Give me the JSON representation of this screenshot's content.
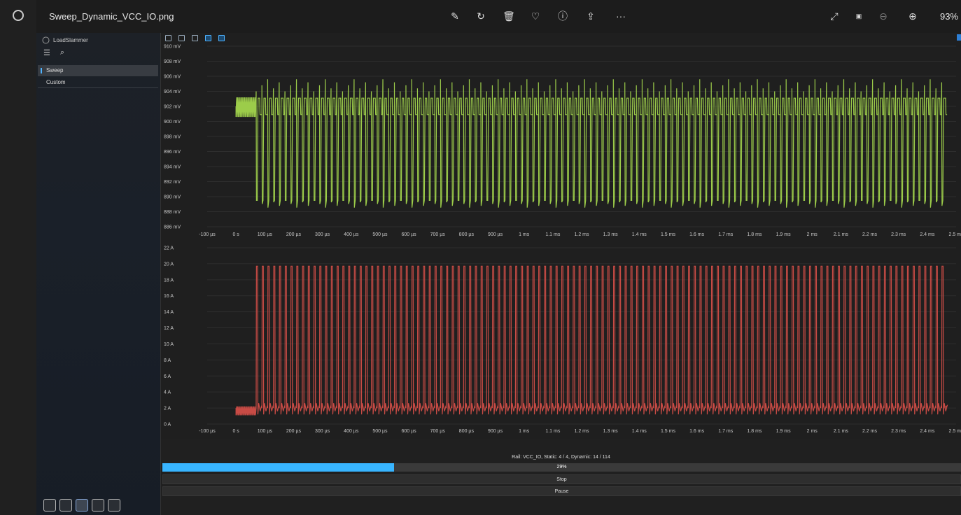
{
  "viewer": {
    "file_name": "Sweep_Dynamic_VCC_IO.png",
    "zoom": "93%",
    "toolbar_icons": [
      "edit-image-icon",
      "rotate-icon",
      "delete-icon",
      "favorite-heart-icon",
      "info-icon",
      "share-icon",
      "more-icon"
    ],
    "right_icons": [
      "expand-icon",
      "actual-size-icon",
      "zoom-out-icon",
      "zoom-in-icon"
    ],
    "more_label": "···"
  },
  "app": {
    "name": "LoadSlammer",
    "nav": [
      "Sweep",
      "Custom"
    ],
    "selected_nav": "Sweep",
    "bottom_icons": [
      "monitor-icon",
      "bike-icon",
      "chart-icon",
      "report-icon",
      "settings-gear-icon"
    ]
  },
  "status": {
    "rail_text": "Rail: VCC_IO, Static: 4 / 4, Dynamic: 14 / 114",
    "progress": 0.29,
    "progress_label": "29%",
    "stop_label": "Stop",
    "pause_label": "Pause"
  },
  "chart_data": [
    {
      "type": "line",
      "ylabel_unit": "mV",
      "y_ticks": [
        "910 mV",
        "908 mV",
        "906 mV",
        "904 mV",
        "902 mV",
        "900 mV",
        "898 mV",
        "896 mV",
        "894 mV",
        "892 mV",
        "890 mV",
        "888 mV",
        "886 mV"
      ],
      "ylim": [
        886,
        910
      ],
      "x_ticks": [
        "-100 µs",
        "0 s",
        "100 µs",
        "200 µs",
        "300 µs",
        "400 µs",
        "500 µs",
        "600 µs",
        "700 µs",
        "800 µs",
        "900 µs",
        "1 ms",
        "1.1 ms",
        "1.2 ms",
        "1.3 ms",
        "1.4 ms",
        "1.5 ms",
        "1.6 ms",
        "1.7 ms",
        "1.8 ms",
        "1.9 ms",
        "2 ms",
        "2.1 ms",
        "2.2 ms",
        "2.3 ms",
        "2.4 ms",
        "2.5 ms"
      ],
      "xlim_us": [
        -100,
        2500
      ],
      "series_color": "#9ccc4a",
      "baseline_mv": 902,
      "low_mv": 889.5,
      "spike_mv": 904,
      "pulse_start_us": 70,
      "pulse_period_us": 20,
      "end_us": 2460
    },
    {
      "type": "line",
      "ylabel_unit": "A",
      "y_ticks": [
        "22 A",
        "20 A",
        "18 A",
        "16 A",
        "14 A",
        "12 A",
        "10 A",
        "8 A",
        "6 A",
        "4 A",
        "2 A",
        "0 A"
      ],
      "ylim": [
        0,
        22
      ],
      "x_ticks": [
        "-100 µs",
        "0 s",
        "100 µs",
        "200 µs",
        "300 µs",
        "400 µs",
        "500 µs",
        "600 µs",
        "700 µs",
        "800 µs",
        "900 µs",
        "1 ms",
        "1.1 ms",
        "1.2 ms",
        "1.3 ms",
        "1.4 ms",
        "1.5 ms",
        "1.6 ms",
        "1.7 ms",
        "1.8 ms",
        "1.9 ms",
        "2 ms",
        "2.1 ms",
        "2.2 ms",
        "2.3 ms",
        "2.4 ms",
        "2.5 ms"
      ],
      "xlim_us": [
        -100,
        2500
      ],
      "series_color": "#c84b45",
      "baseline_a": 2,
      "high_a": 19.7,
      "pulse_start_us": 70,
      "pulse_period_us": 20,
      "end_us": 2460
    }
  ]
}
